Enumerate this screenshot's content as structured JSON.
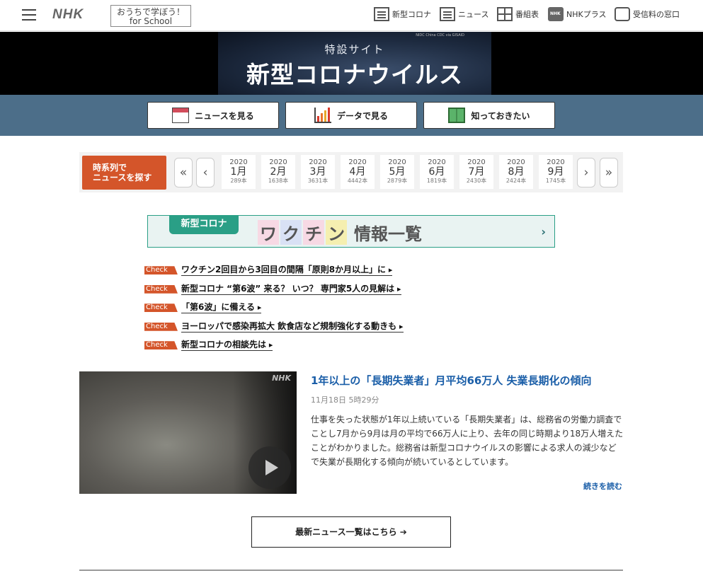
{
  "header": {
    "logo": "NHK",
    "school_line1": "おうちで学ぼう！",
    "school_line2": "for School",
    "nav": [
      {
        "label": "新型コロナ",
        "icon": "corona-news-icon"
      },
      {
        "label": "ニュース",
        "icon": "news-icon"
      },
      {
        "label": "番組表",
        "icon": "program-guide-icon"
      },
      {
        "label": "NHKプラス",
        "icon": "nhk-plus-icon"
      },
      {
        "label": "受信料の窓口",
        "icon": "reception-fee-icon"
      }
    ]
  },
  "banner": {
    "subtitle": "特設サイト",
    "title": "新型コロナウイルス",
    "credit": "NIDC China CDC via GISAID"
  },
  "buttons": {
    "news": "ニュースを見る",
    "data": "データで見る",
    "know": "知っておきたい"
  },
  "timeline": {
    "label": "時系列で\nニュースを探す",
    "first": "«",
    "prev": "‹",
    "next": "›",
    "last": "»",
    "months": [
      {
        "year": "2020",
        "month": "1月",
        "count": "289本"
      },
      {
        "year": "2020",
        "month": "2月",
        "count": "1638本"
      },
      {
        "year": "2020",
        "month": "3月",
        "count": "3631本"
      },
      {
        "year": "2020",
        "month": "4月",
        "count": "4442本"
      },
      {
        "year": "2020",
        "month": "5月",
        "count": "2879本"
      },
      {
        "year": "2020",
        "month": "6月",
        "count": "1819本"
      },
      {
        "year": "2020",
        "month": "7月",
        "count": "2430本"
      },
      {
        "year": "2020",
        "month": "8月",
        "count": "2424本"
      },
      {
        "year": "2020",
        "month": "9月",
        "count": "1745本"
      }
    ]
  },
  "vaccine": {
    "tag": "新型コロナ",
    "chars": [
      "ワ",
      "ク",
      "チ",
      "ン"
    ],
    "rest": "情報一覧",
    "chevron": "›"
  },
  "checks": [
    {
      "tag": "Check",
      "text": "ワクチン2回目から3回目の間隔「原則8か月以上」に"
    },
    {
      "tag": "Check",
      "text": "新型コロナ “第6波” 来る？ いつ？ 専門家5人の見解は"
    },
    {
      "tag": "Check",
      "text": "「第6波」に備える"
    },
    {
      "tag": "Check",
      "text": "ヨーロッパで感染再拡大 飲食店など規制強化する動きも"
    },
    {
      "tag": "Check",
      "text": "新型コロナの相談先は"
    }
  ],
  "article": {
    "watermark": "NHK",
    "title": "1年以上の「長期失業者」月平均66万人 失業長期化の傾向",
    "date": "11月18日 5時29分",
    "body": "仕事を失った状態が1年以上続いている「長期失業者」は、総務省の労働力調査でことし7月から9月は月の平均で66万人に上り、去年の同じ時期より18万人増えたことがわかりました。総務省は新型コロナウイルスの影響による求人の減少などで失業が長期化する傾向が続いているとしています。",
    "more": "続きを読む"
  },
  "latest": "最新ニュース一覧はこちら ➔"
}
